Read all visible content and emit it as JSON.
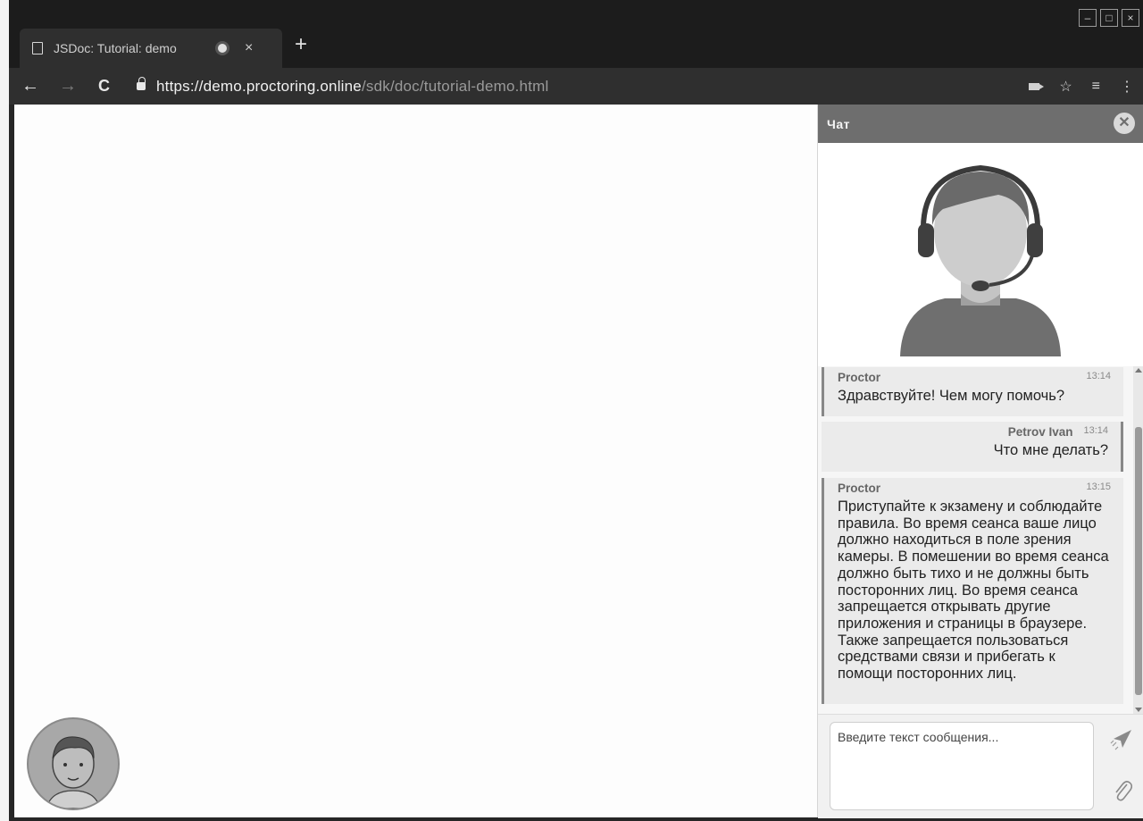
{
  "browser": {
    "tab_title": "JSDoc: Tutorial: demo",
    "tab_close": "×",
    "new_tab": "+",
    "url_host": "https://demo.proctoring.online",
    "url_path": "/sdk/doc/tutorial-demo.html",
    "window_controls": [
      "–",
      "□",
      "×"
    ],
    "icons": [
      "back-icon",
      "forward-icon",
      "reload-icon",
      "lock-icon",
      "camera-icon",
      "star-icon",
      "extension-icon",
      "menu-icon"
    ]
  },
  "chat": {
    "title": "Чат",
    "close_label": "✕",
    "messages": [
      {
        "name": "Proctor",
        "time": "13:14",
        "text": "Здравствуйте! Чем могу помочь?",
        "side": "left"
      },
      {
        "name": "Petrov Ivan",
        "time": "13:14",
        "text": "Что мне делать?",
        "side": "right"
      },
      {
        "name": "Proctor",
        "time": "13:15",
        "text": "Приступайте к экзамену и соблюдайте правила. Во время сеанса ваше лицо должно находиться в поле зрения камеры. В помешении во время сеанса должно быть тихо и не должны быть посторонних лиц. Во время сеанса запрещается открывать другие приложения и страницы в браузере. Также запрещается пользоваться средствами связи и прибегать к помощи посторонних лиц.",
        "side": "left"
      }
    ],
    "input_placeholder": "Введите текст сообщения...",
    "input_value": ""
  },
  "colors": {
    "chat_header": "#6e6e6e",
    "browser_dark": "#2f2f2f",
    "message_bg": "#ebebeb"
  }
}
